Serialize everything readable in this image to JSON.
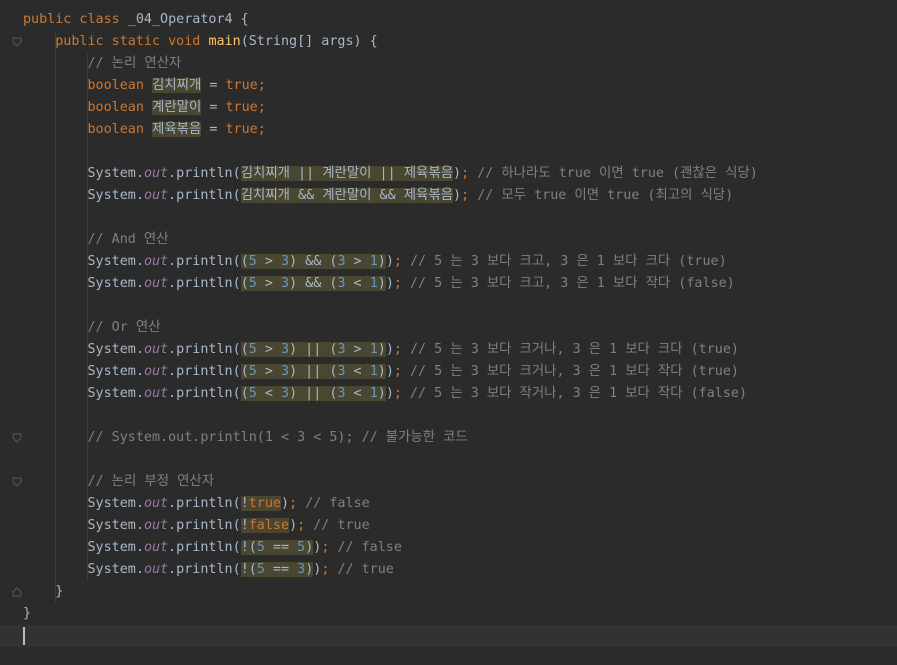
{
  "editor": {
    "language": "java",
    "class_name": "_04_Operator4",
    "cursor_line": 28,
    "lines": [
      {
        "indent": 0,
        "fold": "none",
        "tokens": [
          {
            "t": "public class ",
            "k": "kw"
          },
          {
            "t": "_04_Operator4 {",
            "k": "p"
          }
        ]
      },
      {
        "indent": 1,
        "fold": "open",
        "tokens": [
          {
            "t": "public static void ",
            "k": "kw"
          },
          {
            "t": "main",
            "k": "fn"
          },
          {
            "t": "(String[] args) {",
            "k": "p"
          }
        ]
      },
      {
        "indent": 2,
        "fold": "none",
        "tokens": [
          {
            "t": "// 논리 연산자",
            "k": "cm"
          }
        ]
      },
      {
        "indent": 2,
        "fold": "none",
        "tokens": [
          {
            "t": "boolean ",
            "k": "kw"
          },
          {
            "t": "김치찌개",
            "k": "p",
            "h": true
          },
          {
            "t": " = ",
            "k": "p"
          },
          {
            "t": "true",
            "k": "kw"
          },
          {
            "t": ";",
            "k": "kw"
          }
        ]
      },
      {
        "indent": 2,
        "fold": "none",
        "tokens": [
          {
            "t": "boolean ",
            "k": "kw"
          },
          {
            "t": "계란말이",
            "k": "p",
            "h": true
          },
          {
            "t": " = ",
            "k": "p"
          },
          {
            "t": "true",
            "k": "kw"
          },
          {
            "t": ";",
            "k": "kw"
          }
        ]
      },
      {
        "indent": 2,
        "fold": "none",
        "tokens": [
          {
            "t": "boolean ",
            "k": "kw"
          },
          {
            "t": "제육볶음",
            "k": "p",
            "h": true
          },
          {
            "t": " = ",
            "k": "p"
          },
          {
            "t": "true",
            "k": "kw"
          },
          {
            "t": ";",
            "k": "kw"
          }
        ]
      },
      {
        "indent": 2,
        "fold": "none",
        "tokens": []
      },
      {
        "indent": 2,
        "fold": "none",
        "tokens": [
          {
            "t": "System.",
            "k": "p"
          },
          {
            "t": "out",
            "k": "fld"
          },
          {
            "t": ".println(",
            "k": "p"
          },
          {
            "t": "김치찌개 || 계란말이 || 제육볶음",
            "k": "p",
            "h": true
          },
          {
            "t": ")",
            "k": "p"
          },
          {
            "t": "; ",
            "k": "kw"
          },
          {
            "t": "// 하나라도 true 이면 true (괜찮은 식당)",
            "k": "cm"
          }
        ]
      },
      {
        "indent": 2,
        "fold": "none",
        "tokens": [
          {
            "t": "System.",
            "k": "p"
          },
          {
            "t": "out",
            "k": "fld"
          },
          {
            "t": ".println(",
            "k": "p"
          },
          {
            "t": "김치찌개 && 계란말이 && 제육볶음",
            "k": "p",
            "h": true
          },
          {
            "t": ")",
            "k": "p"
          },
          {
            "t": "; ",
            "k": "kw"
          },
          {
            "t": "// 모두 true 이면 true (최고의 식당)",
            "k": "cm"
          }
        ]
      },
      {
        "indent": 2,
        "fold": "none",
        "tokens": []
      },
      {
        "indent": 2,
        "fold": "none",
        "tokens": [
          {
            "t": "// And 연산",
            "k": "cm"
          }
        ]
      },
      {
        "indent": 2,
        "fold": "none",
        "tokens": [
          {
            "t": "System.",
            "k": "p"
          },
          {
            "t": "out",
            "k": "fld"
          },
          {
            "t": ".println(",
            "k": "p"
          },
          {
            "t": "(",
            "k": "p",
            "h": true
          },
          {
            "t": "5",
            "k": "num",
            "h": true
          },
          {
            "t": " > ",
            "k": "p",
            "h": true
          },
          {
            "t": "3",
            "k": "num",
            "h": true
          },
          {
            "t": ") && (",
            "k": "p",
            "h": true
          },
          {
            "t": "3",
            "k": "num",
            "h": true
          },
          {
            "t": " > ",
            "k": "p",
            "h": true
          },
          {
            "t": "1",
            "k": "num",
            "h": true
          },
          {
            "t": ")",
            "k": "p",
            "h": true
          },
          {
            "t": ")",
            "k": "p"
          },
          {
            "t": "; ",
            "k": "kw"
          },
          {
            "t": "// 5 는 3 보다 크고, 3 은 1 보다 크다 (true)",
            "k": "cm"
          }
        ]
      },
      {
        "indent": 2,
        "fold": "none",
        "tokens": [
          {
            "t": "System.",
            "k": "p"
          },
          {
            "t": "out",
            "k": "fld"
          },
          {
            "t": ".println(",
            "k": "p"
          },
          {
            "t": "(",
            "k": "p",
            "h": true
          },
          {
            "t": "5",
            "k": "num",
            "h": true
          },
          {
            "t": " > ",
            "k": "p",
            "h": true
          },
          {
            "t": "3",
            "k": "num",
            "h": true
          },
          {
            "t": ") && (",
            "k": "p",
            "h": true
          },
          {
            "t": "3",
            "k": "num",
            "h": true
          },
          {
            "t": " < ",
            "k": "p",
            "h": true
          },
          {
            "t": "1",
            "k": "num",
            "h": true
          },
          {
            "t": ")",
            "k": "p",
            "h": true
          },
          {
            "t": ")",
            "k": "p"
          },
          {
            "t": "; ",
            "k": "kw"
          },
          {
            "t": "// 5 는 3 보다 크고, 3 은 1 보다 작다 (false)",
            "k": "cm"
          }
        ]
      },
      {
        "indent": 2,
        "fold": "none",
        "tokens": []
      },
      {
        "indent": 2,
        "fold": "none",
        "tokens": [
          {
            "t": "// Or 연산",
            "k": "cm"
          }
        ]
      },
      {
        "indent": 2,
        "fold": "none",
        "tokens": [
          {
            "t": "System.",
            "k": "p"
          },
          {
            "t": "out",
            "k": "fld"
          },
          {
            "t": ".println(",
            "k": "p"
          },
          {
            "t": "(",
            "k": "p",
            "h": true
          },
          {
            "t": "5",
            "k": "num",
            "h": true
          },
          {
            "t": " > ",
            "k": "p",
            "h": true
          },
          {
            "t": "3",
            "k": "num",
            "h": true
          },
          {
            "t": ") || (",
            "k": "p",
            "h": true
          },
          {
            "t": "3",
            "k": "num",
            "h": true
          },
          {
            "t": " > ",
            "k": "p",
            "h": true
          },
          {
            "t": "1",
            "k": "num",
            "h": true
          },
          {
            "t": ")",
            "k": "p",
            "h": true
          },
          {
            "t": ")",
            "k": "p"
          },
          {
            "t": "; ",
            "k": "kw"
          },
          {
            "t": "// 5 는 3 보다 크거나, 3 은 1 보다 크다 (true)",
            "k": "cm"
          }
        ]
      },
      {
        "indent": 2,
        "fold": "none",
        "tokens": [
          {
            "t": "System.",
            "k": "p"
          },
          {
            "t": "out",
            "k": "fld"
          },
          {
            "t": ".println(",
            "k": "p"
          },
          {
            "t": "(",
            "k": "p",
            "h": true
          },
          {
            "t": "5",
            "k": "num",
            "h": true
          },
          {
            "t": " > ",
            "k": "p",
            "h": true
          },
          {
            "t": "3",
            "k": "num",
            "h": true
          },
          {
            "t": ") || (",
            "k": "p",
            "h": true
          },
          {
            "t": "3",
            "k": "num",
            "h": true
          },
          {
            "t": " < ",
            "k": "p",
            "h": true
          },
          {
            "t": "1",
            "k": "num",
            "h": true
          },
          {
            "t": ")",
            "k": "p",
            "h": true
          },
          {
            "t": ")",
            "k": "p"
          },
          {
            "t": "; ",
            "k": "kw"
          },
          {
            "t": "// 5 는 3 보다 크거나, 3 은 1 보다 작다 (true)",
            "k": "cm"
          }
        ]
      },
      {
        "indent": 2,
        "fold": "none",
        "tokens": [
          {
            "t": "System.",
            "k": "p"
          },
          {
            "t": "out",
            "k": "fld"
          },
          {
            "t": ".println(",
            "k": "p"
          },
          {
            "t": "(",
            "k": "p",
            "h": true
          },
          {
            "t": "5",
            "k": "num",
            "h": true
          },
          {
            "t": " < ",
            "k": "p",
            "h": true
          },
          {
            "t": "3",
            "k": "num",
            "h": true
          },
          {
            "t": ") || (",
            "k": "p",
            "h": true
          },
          {
            "t": "3",
            "k": "num",
            "h": true
          },
          {
            "t": " < ",
            "k": "p",
            "h": true
          },
          {
            "t": "1",
            "k": "num",
            "h": true
          },
          {
            "t": ")",
            "k": "p",
            "h": true
          },
          {
            "t": ")",
            "k": "p"
          },
          {
            "t": "; ",
            "k": "kw"
          },
          {
            "t": "// 5 는 3 보다 작거나, 3 은 1 보다 작다 (false)",
            "k": "cm"
          }
        ]
      },
      {
        "indent": 2,
        "fold": "none",
        "tokens": []
      },
      {
        "indent": 2,
        "fold": "open",
        "tokens": [
          {
            "t": "// System.out.println(1 < 3 < 5); // 불가능한 코드",
            "k": "cm"
          }
        ]
      },
      {
        "indent": 2,
        "fold": "none",
        "tokens": []
      },
      {
        "indent": 2,
        "fold": "open",
        "tokens": [
          {
            "t": "// 논리 부정 연산자",
            "k": "cm"
          }
        ]
      },
      {
        "indent": 2,
        "fold": "none",
        "tokens": [
          {
            "t": "System.",
            "k": "p"
          },
          {
            "t": "out",
            "k": "fld"
          },
          {
            "t": ".println(",
            "k": "p"
          },
          {
            "t": "!",
            "k": "p",
            "h": true
          },
          {
            "t": "true",
            "k": "kw",
            "h": true
          },
          {
            "t": ")",
            "k": "p"
          },
          {
            "t": "; ",
            "k": "kw"
          },
          {
            "t": "// false",
            "k": "cm"
          }
        ]
      },
      {
        "indent": 2,
        "fold": "none",
        "tokens": [
          {
            "t": "System.",
            "k": "p"
          },
          {
            "t": "out",
            "k": "fld"
          },
          {
            "t": ".println(",
            "k": "p"
          },
          {
            "t": "!",
            "k": "p",
            "h": true
          },
          {
            "t": "false",
            "k": "kw",
            "h": true
          },
          {
            "t": ")",
            "k": "p"
          },
          {
            "t": "; ",
            "k": "kw"
          },
          {
            "t": "// true",
            "k": "cm"
          }
        ]
      },
      {
        "indent": 2,
        "fold": "none",
        "tokens": [
          {
            "t": "System.",
            "k": "p"
          },
          {
            "t": "out",
            "k": "fld"
          },
          {
            "t": ".println(",
            "k": "p"
          },
          {
            "t": "!(",
            "k": "p",
            "h": true
          },
          {
            "t": "5",
            "k": "num",
            "h": true
          },
          {
            "t": " == ",
            "k": "p",
            "h": true
          },
          {
            "t": "5",
            "k": "num",
            "h": true
          },
          {
            "t": ")",
            "k": "p",
            "h": true
          },
          {
            "t": ")",
            "k": "p"
          },
          {
            "t": "; ",
            "k": "kw"
          },
          {
            "t": "// false",
            "k": "cm"
          }
        ]
      },
      {
        "indent": 2,
        "fold": "none",
        "tokens": [
          {
            "t": "System.",
            "k": "p"
          },
          {
            "t": "out",
            "k": "fld"
          },
          {
            "t": ".println(",
            "k": "p"
          },
          {
            "t": "!(",
            "k": "p",
            "h": true
          },
          {
            "t": "5",
            "k": "num",
            "h": true
          },
          {
            "t": " == ",
            "k": "p",
            "h": true
          },
          {
            "t": "3",
            "k": "num",
            "h": true
          },
          {
            "t": ")",
            "k": "p",
            "h": true
          },
          {
            "t": ")",
            "k": "p"
          },
          {
            "t": "; ",
            "k": "kw"
          },
          {
            "t": "// true",
            "k": "cm"
          }
        ]
      },
      {
        "indent": 1,
        "fold": "close",
        "tokens": [
          {
            "t": "}",
            "k": "p"
          }
        ]
      },
      {
        "indent": 0,
        "fold": "none",
        "tokens": [
          {
            "t": "}",
            "k": "p"
          }
        ]
      },
      {
        "indent": 0,
        "fold": "none",
        "tokens": []
      }
    ]
  },
  "colors": {
    "background": "#2b2b2b",
    "current_line": "#323232",
    "keyword": "#cc7832",
    "comment": "#808080",
    "number": "#6897bb",
    "field": "#9876aa",
    "method": "#ffc66d",
    "plain": "#a9b7c6",
    "highlight": "#494631",
    "guide": "#3b3b3b",
    "fold_marker": "#5a5a5a"
  },
  "icons": {
    "fold_open": "fold-open-icon",
    "fold_close": "fold-close-icon"
  }
}
